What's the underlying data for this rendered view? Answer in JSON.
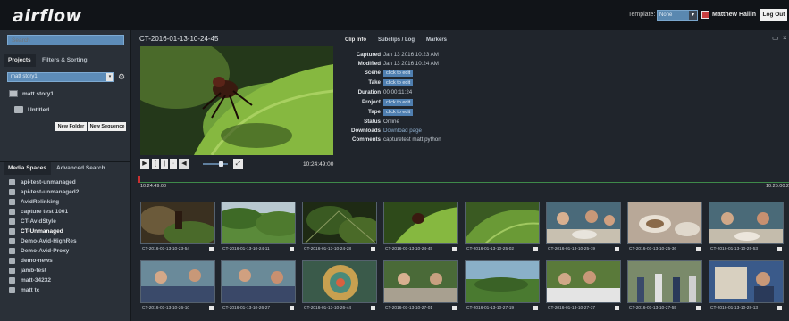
{
  "app": {
    "logo": "airflow"
  },
  "header": {
    "template_label": "Template:",
    "template_value": "None",
    "user_name": "Matthew Hallin",
    "logout": "Log Out"
  },
  "left": {
    "search_placeholder": "Search",
    "tabs": [
      "Projects",
      "Filters & Sorting"
    ],
    "project_select": "matt story1",
    "tree": [
      "matt story1",
      "Untitled"
    ],
    "new_folder": "New Folder",
    "new_sequence": "New Sequence",
    "media_tabs": [
      "Media Spaces",
      "Advanced Search"
    ],
    "media_spaces": [
      "api-test-unmanaged",
      "api-test-unmanaged2",
      "AvidRelinking",
      "capture test 1001",
      "CT-AvidStyle",
      "CT-Unmanaged",
      "Demo-Avid-HighRes",
      "Demo-Avid-Proxy",
      "demo-news",
      "jamb-test",
      "matt-34232",
      "matt tc"
    ]
  },
  "clip": {
    "title": "CT-2016-01-13-10-24-45",
    "timecode": "10:24:49:00"
  },
  "info": {
    "tabs": [
      "Clip Info",
      "Subclips / Log",
      "Markers"
    ],
    "rows": [
      {
        "label": "Captured",
        "value": "Jan 13 2016 10:23 AM",
        "kind": "text"
      },
      {
        "label": "Modified",
        "value": "Jan 13 2016 10:24 AM",
        "kind": "text"
      },
      {
        "label": "Scene",
        "value": "click to edit",
        "kind": "edit"
      },
      {
        "label": "Take",
        "value": "click to edit",
        "kind": "edit"
      },
      {
        "label": "Duration",
        "value": "00:00:11:24",
        "kind": "text"
      },
      {
        "label": "Project",
        "value": "click to edit",
        "kind": "edit"
      },
      {
        "label": "Tape",
        "value": "click to edit",
        "kind": "edit"
      },
      {
        "label": "Status",
        "value": "Online",
        "kind": "text"
      },
      {
        "label": "Downloads",
        "value": "Download page",
        "kind": "link"
      },
      {
        "label": "Comments",
        "value": "capturetest matt python",
        "kind": "text"
      }
    ]
  },
  "timeline": {
    "start": "10:24:49:00",
    "end": "10:25:00:2"
  },
  "thumbnails": [
    "CT-2016-01-13-10-23-54",
    "CT-2016-01-13-10-24-11",
    "CT-2016-01-13-10-24-28",
    "CT-2016-01-13-10-24-45",
    "CT-2016-01-13-10-25-02",
    "CT-2016-01-13-10-25-19",
    "CT-2016-01-13-10-25-36",
    "CT-2016-01-13-10-25-53",
    "CT-2016-01-13-10-26-10",
    "CT-2016-01-13-10-26-27",
    "CT-2016-01-13-10-26-44",
    "CT-2016-01-13-10-27-01",
    "CT-2016-01-13-10-27-19",
    "CT-2016-01-13-10-27-37",
    "CT-2016-01-13-10-27-55",
    "CT-2016-01-13-10-28-13"
  ],
  "colors": {
    "accent": "#5d8cb8",
    "topbar": "#111418",
    "timeline": "#3e8a4a"
  }
}
